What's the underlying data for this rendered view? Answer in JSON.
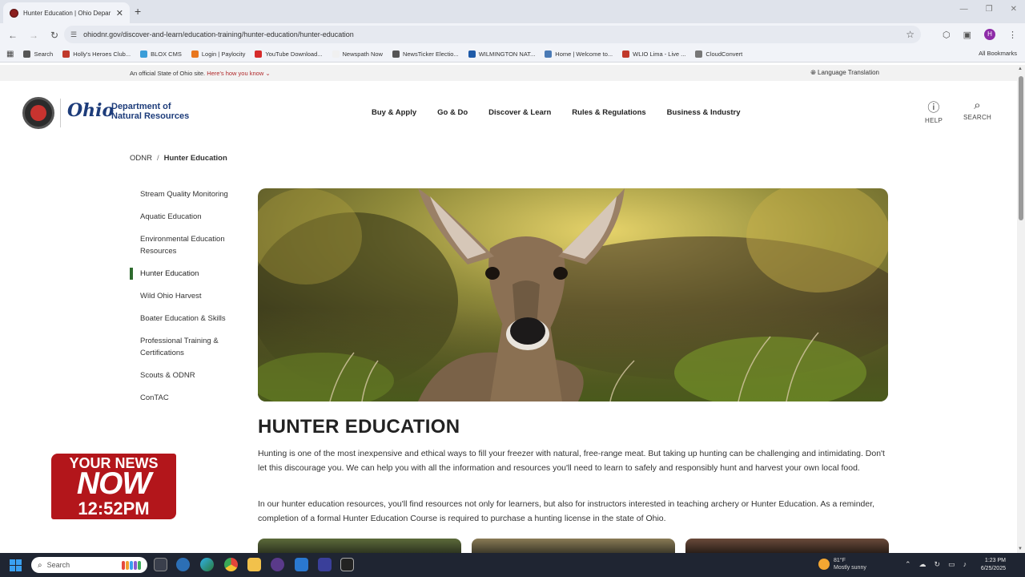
{
  "browser": {
    "tab_title": "Hunter Education | Ohio Depar",
    "tab_close": "✕",
    "new_tab": "+",
    "url": "ohiodnr.gov/discover-and-learn/education-training/hunter-education/hunter-education",
    "profile_initial": "H",
    "bookmarks": [
      {
        "label": "Search",
        "color": "#555555"
      },
      {
        "label": "Holly's Heroes Club...",
        "color": "#c0392b"
      },
      {
        "label": "BLOX CMS",
        "color": "#3b9dd8"
      },
      {
        "label": "Login | Paylocity",
        "color": "#e8771e"
      },
      {
        "label": "YouTube Download...",
        "color": "#d62b2b"
      },
      {
        "label": "Newspath Now",
        "color": "#f0f0f0"
      },
      {
        "label": "NewsTicker Electio...",
        "color": "#555555"
      },
      {
        "label": "WILMINGTON NAT...",
        "color": "#1e5aa8"
      },
      {
        "label": "Home | Welcome to...",
        "color": "#4a7ab5"
      },
      {
        "label": "WLIO Lima - Live ...",
        "color": "#c0392b"
      },
      {
        "label": "CloudConvert",
        "color": "#777777"
      }
    ],
    "all_bookmarks": "All Bookmarks"
  },
  "site": {
    "official_text": "An official State of Ohio site.",
    "official_link": "Here's how you know",
    "language": "Language Translation",
    "logo_ohio": "Ohio",
    "dept_line1": "Department of",
    "dept_line2": "Natural Resources",
    "nav": [
      "Buy & Apply",
      "Go & Do",
      "Discover & Learn",
      "Rules & Regulations",
      "Business & Industry"
    ],
    "help_label": "HELP",
    "search_label": "SEARCH"
  },
  "breadcrumb": {
    "root": "ODNR",
    "sep": "/",
    "current": "Hunter Education"
  },
  "sidenav": [
    {
      "label": "Stream Quality Monitoring",
      "active": false
    },
    {
      "label": "Aquatic Education",
      "active": false
    },
    {
      "label": "Environmental Education Resources",
      "active": false
    },
    {
      "label": "Hunter Education",
      "active": true
    },
    {
      "label": "Wild Ohio Harvest",
      "active": false
    },
    {
      "label": "Boater Education & Skills",
      "active": false
    },
    {
      "label": "Professional Training & Certifications",
      "active": false
    },
    {
      "label": "Scouts & ODNR",
      "active": false
    },
    {
      "label": "ConTAC",
      "active": false
    }
  ],
  "content": {
    "title": "HUNTER EDUCATION",
    "p1": "Hunting is one of the most inexpensive and ethical ways to fill your freezer with natural, free-range meat. But taking up hunting can be challenging and intimidating. Don't let this discourage you. We can help you with all the information and resources you'll need to learn to safely and responsibly hunt and harvest your own local food.",
    "p2": "In our hunter education resources, you'll find resources not only for learners, but also for instructors interested in teaching archery or Hunter Education. As a reminder, completion of a formal Hunter Education Course is required to purchase a hunting license in the state of Ohio."
  },
  "overlay": {
    "line1": "YOUR NEWS",
    "line2": "NOW",
    "time": "12:52PM"
  },
  "taskbar": {
    "search_label": "Search",
    "weather_temp": "81°F",
    "weather_desc": "Mostly sunny",
    "time": "1:23 PM",
    "date": "6/25/2025"
  }
}
